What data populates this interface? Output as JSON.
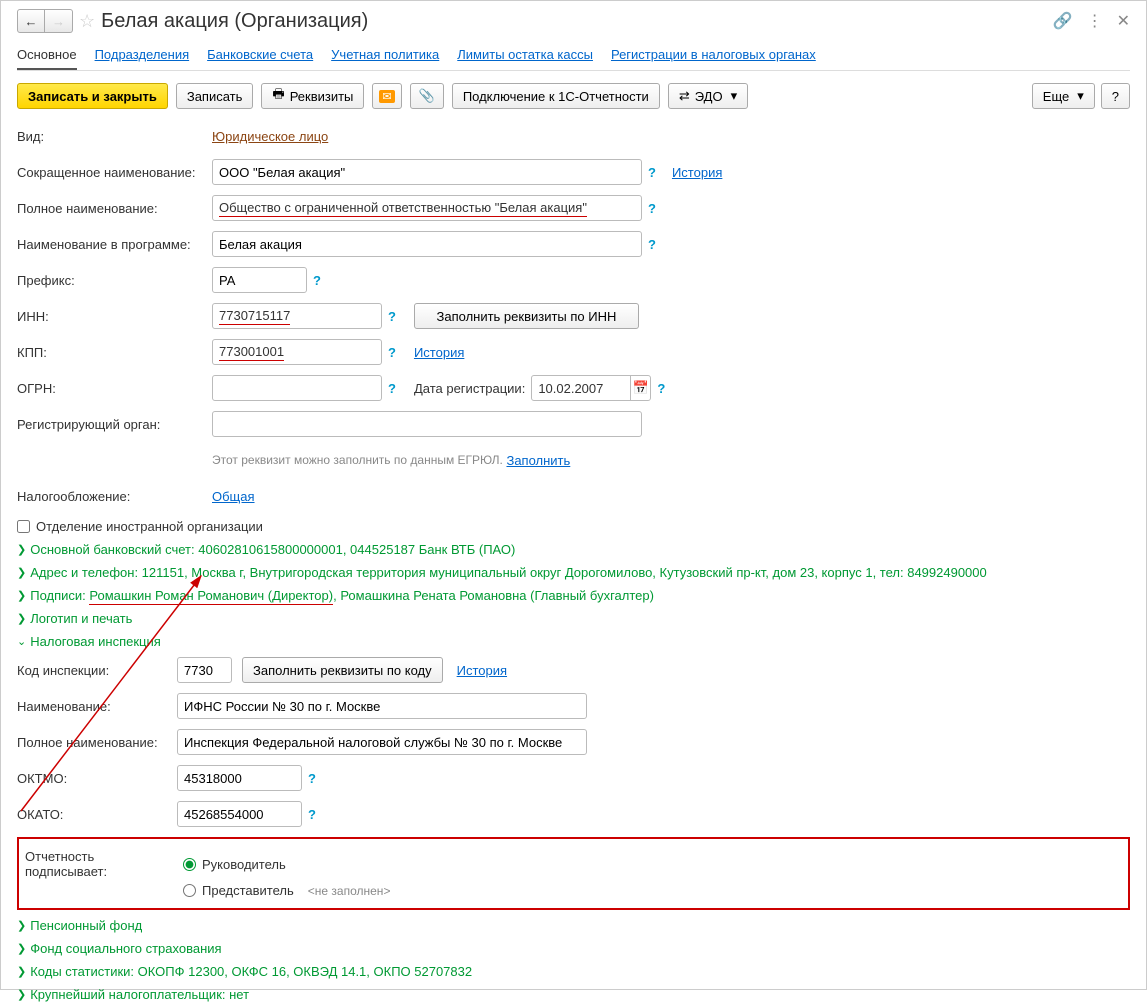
{
  "header": {
    "title": "Белая акация (Организация)"
  },
  "tabs": [
    "Основное",
    "Подразделения",
    "Банковские счета",
    "Учетная политика",
    "Лимиты остатка кассы",
    "Регистрации в налоговых органах"
  ],
  "toolbar": {
    "save_close": "Записать и закрыть",
    "save": "Записать",
    "requisites": "Реквизиты",
    "connect_1c": "Подключение к 1С-Отчетности",
    "edo": "ЭДО",
    "more": "Еще",
    "help": "?"
  },
  "fields": {
    "type_label": "Вид:",
    "type_value": "Юридическое лицо",
    "short_name_label": "Сокращенное наименование:",
    "short_name_value": "ООО \"Белая акация\"",
    "history_link": "История",
    "full_name_label": "Полное наименование:",
    "full_name_value": "Общество с ограниченной ответственностью \"Белая акация\"",
    "program_name_label": "Наименование в программе:",
    "program_name_value": "Белая акация",
    "prefix_label": "Префикс:",
    "prefix_value": "РА",
    "inn_label": "ИНН:",
    "inn_value": "7730715117",
    "fill_by_inn": "Заполнить реквизиты по ИНН",
    "kpp_label": "КПП:",
    "kpp_value": "773001001",
    "ogrn_label": "ОГРН:",
    "ogrn_value": "",
    "reg_date_label": "Дата регистрации:",
    "reg_date_value": "10.02.2007",
    "reg_org_label": "Регистрирующий орган:",
    "reg_org_value": "",
    "reg_hint": "Этот реквизит можно заполнить по данным ЕГРЮЛ.",
    "fill_link": "Заполнить",
    "tax_label": "Налогообложение:",
    "tax_value": "Общая",
    "foreign_branch": "Отделение иностранной организации"
  },
  "expanders": {
    "bank": "Основной банковский счет: 40602810615800000001, 044525187 Банк ВТБ (ПАО)",
    "address": "Адрес и телефон: 121151, Москва г, Внутригородская территория муниципальный округ Дорогомилово, Кутузовский пр-кт, дом 23, корпус 1, тел: 84992490000",
    "signatures_prefix": "Подписи: ",
    "signatures_underlined": "Ромашкин Роман Романович (Директор)",
    "signatures_rest": ", Ромашкина Рената Романовна (Главный бухгалтер)",
    "logo": "Логотип и печать",
    "tax_inspection": "Налоговая инспекция",
    "pension": "Пенсионный фонд",
    "social": "Фонд социального страхования",
    "stats": "Коды статистики: ОКОПФ 12300, ОКФС 16, ОКВЭД 14.1, ОКПО 52707832",
    "big_taxpayer": "Крупнейший налогоплательщик: нет"
  },
  "inspection": {
    "code_label": "Код инспекции:",
    "code_value": "7730",
    "fill_by_code": "Заполнить реквизиты по коду",
    "name_label": "Наименование:",
    "name_value": "ИФНС России № 30 по г. Москве",
    "full_name_label": "Полное наименование:",
    "full_name_value": "Инспекция Федеральной налоговой службы № 30 по г. Москве",
    "oktmo_label": "ОКТМО:",
    "oktmo_value": "45318000",
    "okato_label": "ОКАТО:",
    "okato_value": "45268554000",
    "signer_label": "Отчетность подписывает:",
    "signer_head": "Руководитель",
    "signer_rep": "Представитель",
    "not_filled": "<не заполнен>"
  }
}
